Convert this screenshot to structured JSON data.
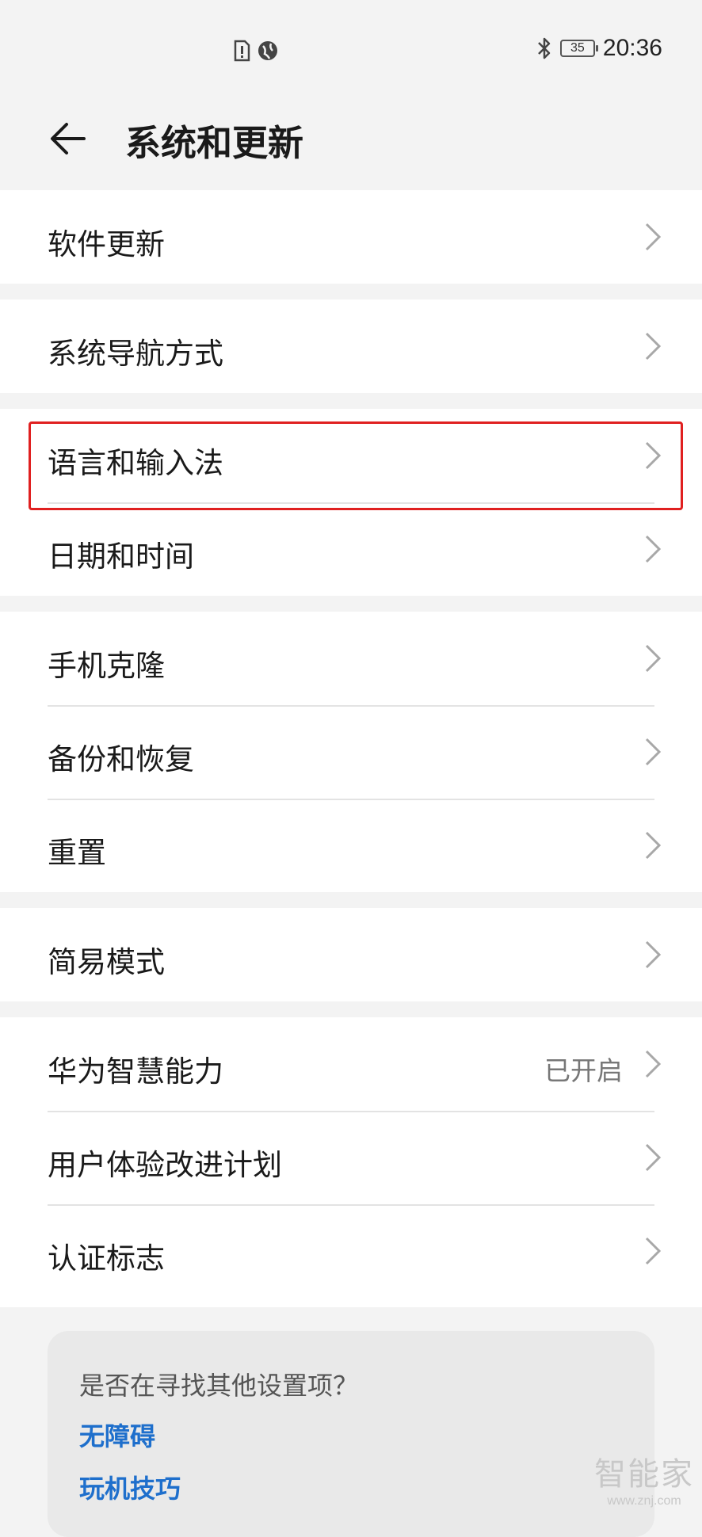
{
  "status_bar": {
    "time": "20:36",
    "battery": "35",
    "icons": [
      "sim-alert-icon",
      "vpn-globe-icon",
      "bluetooth-icon",
      "battery-icon"
    ]
  },
  "header": {
    "back_icon": "back-arrow-icon",
    "title": "系统和更新"
  },
  "groups": [
    {
      "items": [
        {
          "label": "软件更新"
        }
      ]
    },
    {
      "items": [
        {
          "label": "系统导航方式"
        }
      ]
    },
    {
      "items": [
        {
          "label": "语言和输入法",
          "highlighted": true
        },
        {
          "label": "日期和时间"
        }
      ]
    },
    {
      "items": [
        {
          "label": "手机克隆"
        },
        {
          "label": "备份和恢复"
        },
        {
          "label": "重置"
        }
      ]
    },
    {
      "items": [
        {
          "label": "简易模式"
        }
      ]
    },
    {
      "items": [
        {
          "label": "华为智慧能力",
          "value": "已开启"
        },
        {
          "label": "用户体验改进计划"
        },
        {
          "label": "认证标志"
        }
      ]
    }
  ],
  "suggestion_card": {
    "question": "是否在寻找其他设置项？",
    "links": [
      "无障碍",
      "玩机技巧"
    ]
  },
  "watermark": {
    "title": "智能家",
    "url": "www.znj.com"
  },
  "colors": {
    "background": "#f3f3f3",
    "card_bg": "#ffffff",
    "link": "#1e6fcc",
    "highlight": "#e02020"
  }
}
